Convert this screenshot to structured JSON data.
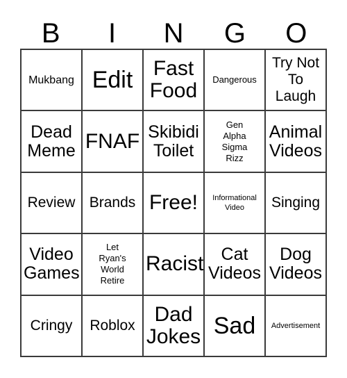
{
  "card": {
    "title": "BINGO",
    "header_letters": [
      "B",
      "I",
      "N",
      "G",
      "O"
    ],
    "background_color": "#ffffff",
    "grid_line_color": "#3a3a3a",
    "text_color": "#000000",
    "rows": 5,
    "columns": 5
  },
  "cells": [
    [
      {
        "text": "Mukbang",
        "size": "sm"
      },
      {
        "text": "Edit",
        "size": "xxl"
      },
      {
        "text": "Fast\nFood",
        "size": "xl"
      },
      {
        "text": "Dangerous",
        "size": "xs"
      },
      {
        "text": "Try Not\nTo\nLaugh",
        "size": "md"
      }
    ],
    [
      {
        "text": "Dead\nMeme",
        "size": "lg"
      },
      {
        "text": "FNAF",
        "size": "xl"
      },
      {
        "text": "Skibidi\nToilet",
        "size": "lg"
      },
      {
        "text": "Gen\nAlpha\nSigma\nRizz",
        "size": "xs"
      },
      {
        "text": "Animal\nVideos",
        "size": "lg"
      }
    ],
    [
      {
        "text": "Review",
        "size": "md"
      },
      {
        "text": "Brands",
        "size": "md"
      },
      {
        "text": "Free!",
        "size": "xl"
      },
      {
        "text": "Informational\nVideo",
        "size": "xxs"
      },
      {
        "text": "Singing",
        "size": "md"
      }
    ],
    [
      {
        "text": "Video\nGames",
        "size": "lg"
      },
      {
        "text": "Let\nRyan's\nWorld\nRetire",
        "size": "xs"
      },
      {
        "text": "Racist",
        "size": "xl"
      },
      {
        "text": "Cat\nVideos",
        "size": "lg"
      },
      {
        "text": "Dog\nVideos",
        "size": "lg"
      }
    ],
    [
      {
        "text": "Cringy",
        "size": "md"
      },
      {
        "text": "Roblox",
        "size": "md"
      },
      {
        "text": "Dad\nJokes",
        "size": "xl"
      },
      {
        "text": "Sad",
        "size": "xxl"
      },
      {
        "text": "Advertisement",
        "size": "xxs"
      }
    ]
  ]
}
